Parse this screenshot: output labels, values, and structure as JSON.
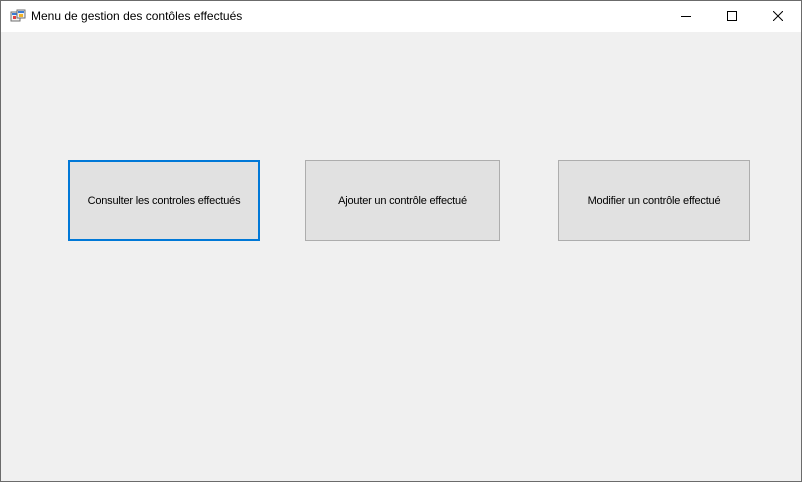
{
  "window": {
    "title": "Menu de gestion des contôles effectués",
    "icon": "form-app-icon",
    "controls": {
      "minimize_icon": "minimize-icon",
      "maximize_icon": "maximize-icon",
      "close_icon": "close-icon"
    }
  },
  "main": {
    "buttons": [
      {
        "label": "Consulter les controles effectués",
        "focused": true
      },
      {
        "label": "Ajouter un contrôle effectué",
        "focused": false
      },
      {
        "label": "Modifier un contrôle effectué",
        "focused": false
      }
    ]
  },
  "colors": {
    "focus_border": "#0078d7",
    "button_face": "#e1e1e1",
    "button_border": "#adadad",
    "client_background": "#f0f0f0",
    "titlebar_background": "#ffffff"
  }
}
